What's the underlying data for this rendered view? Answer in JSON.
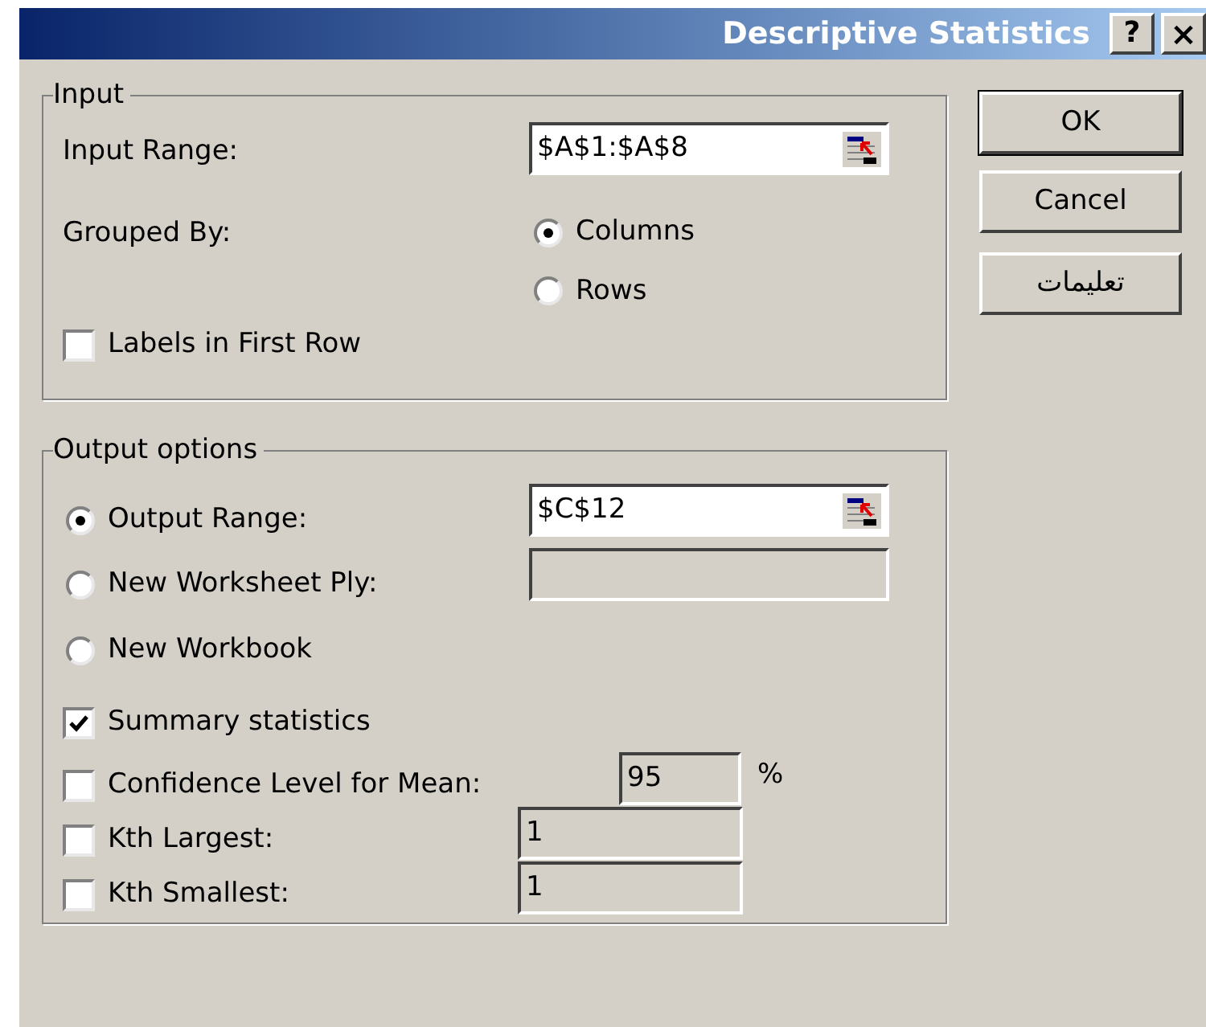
{
  "window": {
    "title": "Descriptive Statistics",
    "help_button": "?",
    "close_button": "×"
  },
  "input_group": {
    "title": "Input",
    "input_range": {
      "label": "Input Range:",
      "value": "$A$1:$A$8"
    },
    "grouped_by": {
      "label": "Grouped By:",
      "options": [
        {
          "label": "Columns",
          "selected": true
        },
        {
          "label": "Rows",
          "selected": false
        }
      ]
    },
    "labels_in_first_row": {
      "label": "Labels in First Row",
      "checked": false
    }
  },
  "output_group": {
    "title": "Output options",
    "destinations": [
      {
        "label": "Output Range:",
        "selected": true,
        "value": "$C$12",
        "picker": true,
        "disabled": false
      },
      {
        "label": "New Worksheet Ply:",
        "selected": false,
        "picker": false,
        "disabled": true
      },
      {
        "label": "New Workbook",
        "selected": false
      }
    ],
    "options": [
      {
        "label": "Summary statistics",
        "checked": true
      },
      {
        "label": "Confidence Level for Mean:",
        "checked": false,
        "value": "95",
        "unit": "%"
      },
      {
        "label": "Kth Largest:",
        "checked": false,
        "value": "1"
      },
      {
        "label": "Kth Smallest:",
        "checked": false,
        "value": "1"
      }
    ]
  },
  "buttons": [
    {
      "label": "OK",
      "default": true
    },
    {
      "label": "Cancel",
      "default": false
    },
    {
      "label": "تعليمات",
      "default": false
    }
  ]
}
